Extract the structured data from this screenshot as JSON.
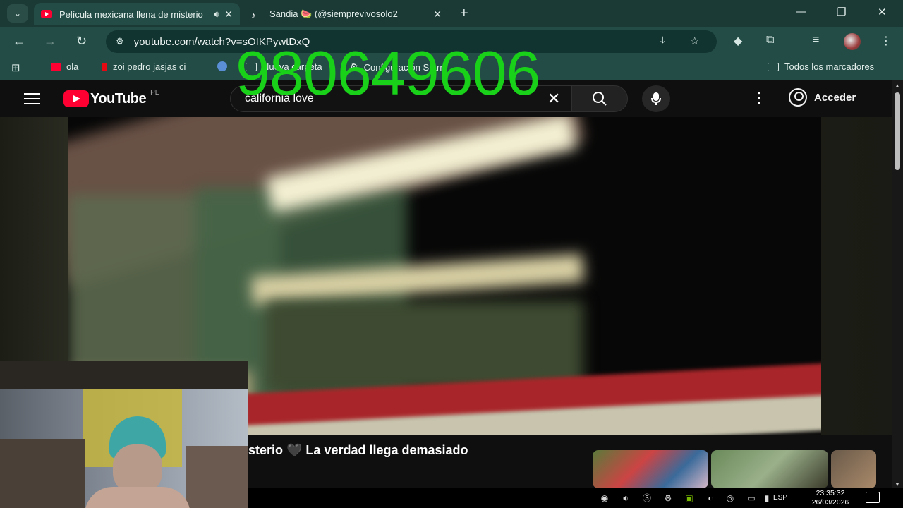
{
  "browser": {
    "tabs": [
      {
        "title": "Película mexicana llena de misterio",
        "favicon": "youtube-icon",
        "audio": true,
        "active": true
      },
      {
        "title": "Sandia 🍉 (@siemprevivosolo2",
        "favicon": "tiktok-icon",
        "active": false
      }
    ],
    "new_tab_label": "+",
    "url": "youtube.com/watch?v=sOIKPywtDxQ",
    "bookmarks": [
      {
        "label": "ola",
        "icon": "youtube-icon"
      },
      {
        "label": "zoi pedro jasjas ci",
        "icon": "netflix-icon"
      },
      {
        "label": "",
        "icon": "globe-icon"
      },
      {
        "label": "Nueva carpeta",
        "icon": "folder-icon"
      },
      {
        "label": "Configuración Starr",
        "icon": "gear-icon"
      }
    ],
    "all_bookmarks_label": "Todos los marcadores"
  },
  "youtube": {
    "logo_text": "YouTube",
    "region": "PE",
    "search_query": "california love",
    "signin_label": "Acceder",
    "video_title_partial": "sterio 🖤 La verdad llega demasiado"
  },
  "overlay": {
    "number": "980649606",
    "color": "#1ad11a"
  },
  "taskbar": {
    "language": "ESP",
    "time": "23:35:32",
    "date": "26/03/2026"
  },
  "colors": {
    "browser_frame": "#244c46",
    "youtube_red": "#ff0033",
    "background": "#0f0f0f"
  }
}
